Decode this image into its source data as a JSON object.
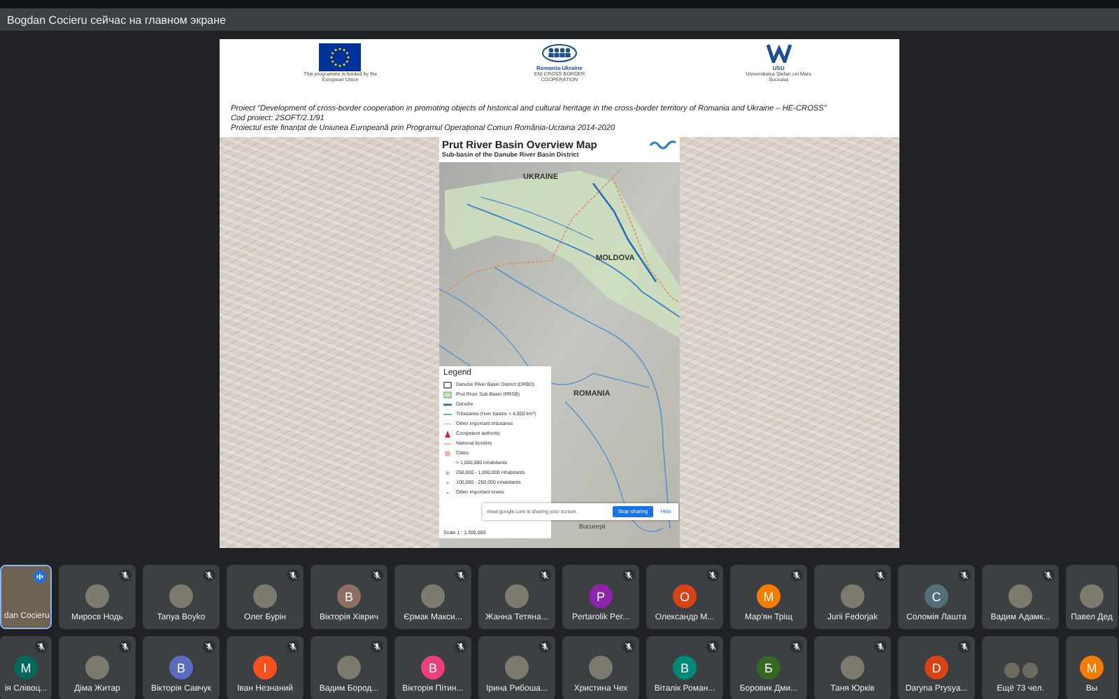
{
  "banner": {
    "text": "Bogdan Cocieru сейчас на главном экране"
  },
  "slide": {
    "logos": [
      {
        "kind": "eu",
        "caption": "This programme is funded by the European Union"
      },
      {
        "kind": "roua",
        "title": "Romania-Ukraine",
        "caption": "ENI CROSS BORDER COOPERATION"
      },
      {
        "kind": "usu",
        "title": "USU",
        "caption": "Universitatea Ştefan cel Mare Suceava"
      }
    ],
    "lines": [
      "Proiect \"Development of cross-border cooperation in promoting objects of historical and cultural heritage in the cross-border territory of Romania and Ukraine – HE-CROSS\"",
      "Cod proiect: 2SOFT/2.1/91",
      "Proiectul este finanțat de Uniunea Europeană  prin Programul Operațional Comun România-Ucraina 2014-2020"
    ],
    "map": {
      "title": "Prut River Basin Overview Map",
      "subtitle": "Sub-basin of the Danube River Basin District",
      "places": [
        "UKRAINE",
        "MOLDOVA",
        "ROMANIA",
        "Bucureşti"
      ],
      "legend": {
        "title": "Legend",
        "items": [
          {
            "kind": "box",
            "label": "Danube River Basin District (DRBD)"
          },
          {
            "kind": "green",
            "label": "Prut River Sub-Basin (PRSB)"
          },
          {
            "kind": "thick",
            "label": "Danube"
          },
          {
            "kind": "river",
            "label": "Tributaries (river basins > 4,000 km²)"
          },
          {
            "kind": "thin",
            "label": "Other important tributaries"
          },
          {
            "kind": "authority",
            "label": "Competent authority"
          },
          {
            "kind": "border",
            "label": "National borders"
          },
          {
            "kind": "large",
            "label": "Cities:"
          },
          {
            "kind": "none",
            "label": "> 1,000,000 inhabitants"
          },
          {
            "kind": "mid",
            "label": "250,000 - 1,000,000 inhabitants"
          },
          {
            "kind": "small",
            "label": "100,000 - 250,000 inhabitants"
          },
          {
            "kind": "town",
            "label": "Other important towns"
          }
        ],
        "scale": "Scale 1 : 1,300,000"
      }
    },
    "share_bar": {
      "message": "meet.google.com is sharing your screen.",
      "stop": "Stop sharing",
      "hide": "Hide"
    }
  },
  "rows": [
    [
      {
        "name": "dan Cocieru",
        "kind": "video",
        "muted": false,
        "speaking": true
      },
      {
        "name": "Миросв Нодь",
        "kind": "photo",
        "muted": true,
        "speaking": false
      },
      {
        "name": "Tanya Boyko",
        "kind": "photo",
        "muted": true,
        "speaking": false
      },
      {
        "name": "Олег Бурін",
        "kind": "photo",
        "muted": true,
        "speaking": false
      },
      {
        "name": "Вікторія Хіврич",
        "kind": "letter",
        "letter": "В",
        "color": "#8d6e63",
        "muted": true,
        "speaking": false
      },
      {
        "name": "Єрмак Макси...",
        "kind": "photo",
        "muted": true,
        "speaking": false
      },
      {
        "name": "Жанна Тетяна...",
        "kind": "photo",
        "muted": true,
        "speaking": false
      },
      {
        "name": "Pertarolik Per...",
        "kind": "letter",
        "letter": "P",
        "color": "#8e24aa",
        "muted": true,
        "speaking": false
      },
      {
        "name": "Олександр М...",
        "kind": "letter",
        "letter": "O",
        "color": "#d84315",
        "muted": true,
        "speaking": false
      },
      {
        "name": "Мар'ян Тріщ",
        "kind": "letter",
        "letter": "M",
        "color": "#f57c00",
        "muted": true,
        "speaking": false
      },
      {
        "name": "Jurii Fedorjak",
        "kind": "photo",
        "muted": true,
        "speaking": false
      },
      {
        "name": "Соломія Лашта",
        "kind": "letter",
        "letter": "C",
        "color": "#546e7a",
        "muted": true,
        "speaking": false
      },
      {
        "name": "Вадим Адамк...",
        "kind": "photo",
        "muted": true,
        "speaking": false
      },
      {
        "name": "Павел Дед",
        "kind": "photo",
        "muted": false,
        "speaking": false
      }
    ],
    [
      {
        "name": "ія Слівоц...",
        "kind": "letter",
        "letter": "M",
        "color": "#00695c",
        "muted": true,
        "speaking": false
      },
      {
        "name": "Діма Житар",
        "kind": "photo",
        "muted": true,
        "speaking": false
      },
      {
        "name": "Вікторія Савчук",
        "kind": "letter",
        "letter": "B",
        "color": "#5c6bc0",
        "muted": true,
        "speaking": false
      },
      {
        "name": "Іван Незнаний",
        "kind": "letter",
        "letter": "I",
        "color": "#f4511e",
        "muted": true,
        "speaking": false
      },
      {
        "name": "Вадим Бород...",
        "kind": "photo",
        "muted": true,
        "speaking": false
      },
      {
        "name": "Вікторія Пітин...",
        "kind": "letter",
        "letter": "B",
        "color": "#ec407a",
        "muted": true,
        "speaking": false
      },
      {
        "name": "Ірина Рибоша...",
        "kind": "photo",
        "muted": true,
        "speaking": false
      },
      {
        "name": "Христина Чех",
        "kind": "photo",
        "muted": true,
        "speaking": false
      },
      {
        "name": "Віталік Роман...",
        "kind": "letter",
        "letter": "B",
        "color": "#00897b",
        "muted": true,
        "speaking": false
      },
      {
        "name": "Боровик Дми...",
        "kind": "letter",
        "letter": "Б",
        "color": "#33691e",
        "muted": true,
        "speaking": false
      },
      {
        "name": "Таня Юрків",
        "kind": "photo",
        "muted": true,
        "speaking": false
      },
      {
        "name": "Darуna Prysya...",
        "kind": "letter",
        "letter": "D",
        "color": "#d84315",
        "muted": true,
        "speaking": false
      },
      {
        "name": "Ещё 73 чел.",
        "kind": "group",
        "muted": false,
        "speaking": false
      },
      {
        "name": "Вы",
        "kind": "letter",
        "letter": "M",
        "color": "#f57c00",
        "muted": false,
        "speaking": false
      }
    ]
  ]
}
